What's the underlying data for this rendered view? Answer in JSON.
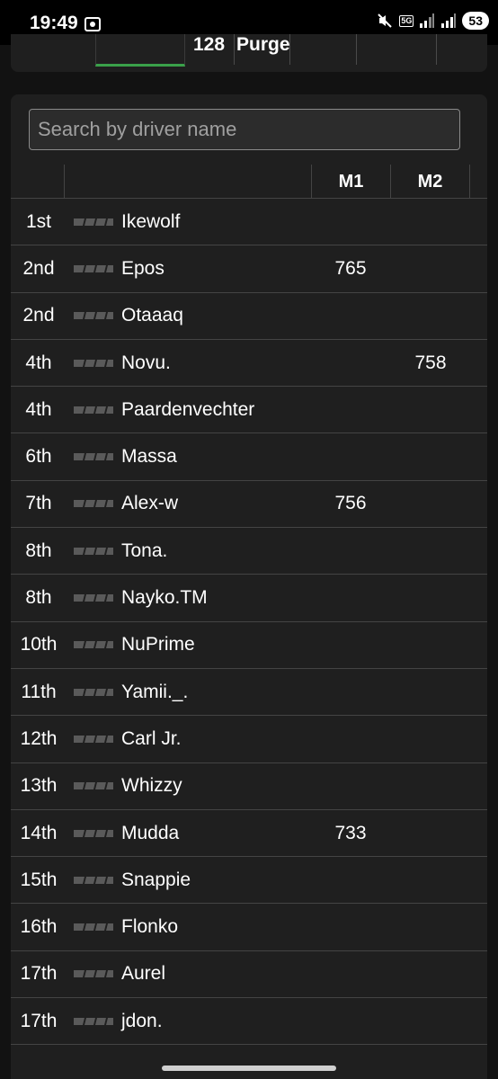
{
  "status_bar": {
    "time": "19:49",
    "network": "5G",
    "battery": "53"
  },
  "top_nav": {
    "items": [
      "128",
      "Purge"
    ]
  },
  "search": {
    "placeholder": "Search by driver name"
  },
  "table": {
    "columns": [
      "",
      "",
      "M1",
      "M2"
    ],
    "rows": [
      {
        "pos": "1st",
        "name": "Ikewolf",
        "m1": "",
        "m2": ""
      },
      {
        "pos": "2nd",
        "name": "Epos",
        "m1": "765",
        "m2": ""
      },
      {
        "pos": "2nd",
        "name": "Otaaaq",
        "m1": "",
        "m2": ""
      },
      {
        "pos": "4th",
        "name": "Novu.",
        "m1": "",
        "m2": "758"
      },
      {
        "pos": "4th",
        "name": "Paardenvechter",
        "m1": "",
        "m2": ""
      },
      {
        "pos": "6th",
        "name": "Massa",
        "m1": "",
        "m2": ""
      },
      {
        "pos": "7th",
        "name": "Alex-w",
        "m1": "756",
        "m2": ""
      },
      {
        "pos": "8th",
        "name": "Tona.",
        "m1": "",
        "m2": ""
      },
      {
        "pos": "8th",
        "name": "Nayko.TM",
        "m1": "",
        "m2": ""
      },
      {
        "pos": "10th",
        "name": "NuPrime",
        "m1": "",
        "m2": ""
      },
      {
        "pos": "11th",
        "name": "Yamii._.",
        "m1": "",
        "m2": ""
      },
      {
        "pos": "12th",
        "name": "Carl Jr.",
        "m1": "",
        "m2": ""
      },
      {
        "pos": "13th",
        "name": "Whizzy",
        "m1": "",
        "m2": ""
      },
      {
        "pos": "14th",
        "name": "Mudda",
        "m1": "733",
        "m2": ""
      },
      {
        "pos": "15th",
        "name": "Snappie",
        "m1": "",
        "m2": ""
      },
      {
        "pos": "16th",
        "name": "Flonko",
        "m1": "",
        "m2": ""
      },
      {
        "pos": "17th",
        "name": "Aurel",
        "m1": "",
        "m2": ""
      },
      {
        "pos": "17th",
        "name": "jdon.",
        "m1": "",
        "m2": ""
      }
    ]
  },
  "colors": {
    "background": "#121212",
    "card": "#1f1f1f",
    "accent_green": "#3aa14a",
    "divider": "#444444"
  }
}
